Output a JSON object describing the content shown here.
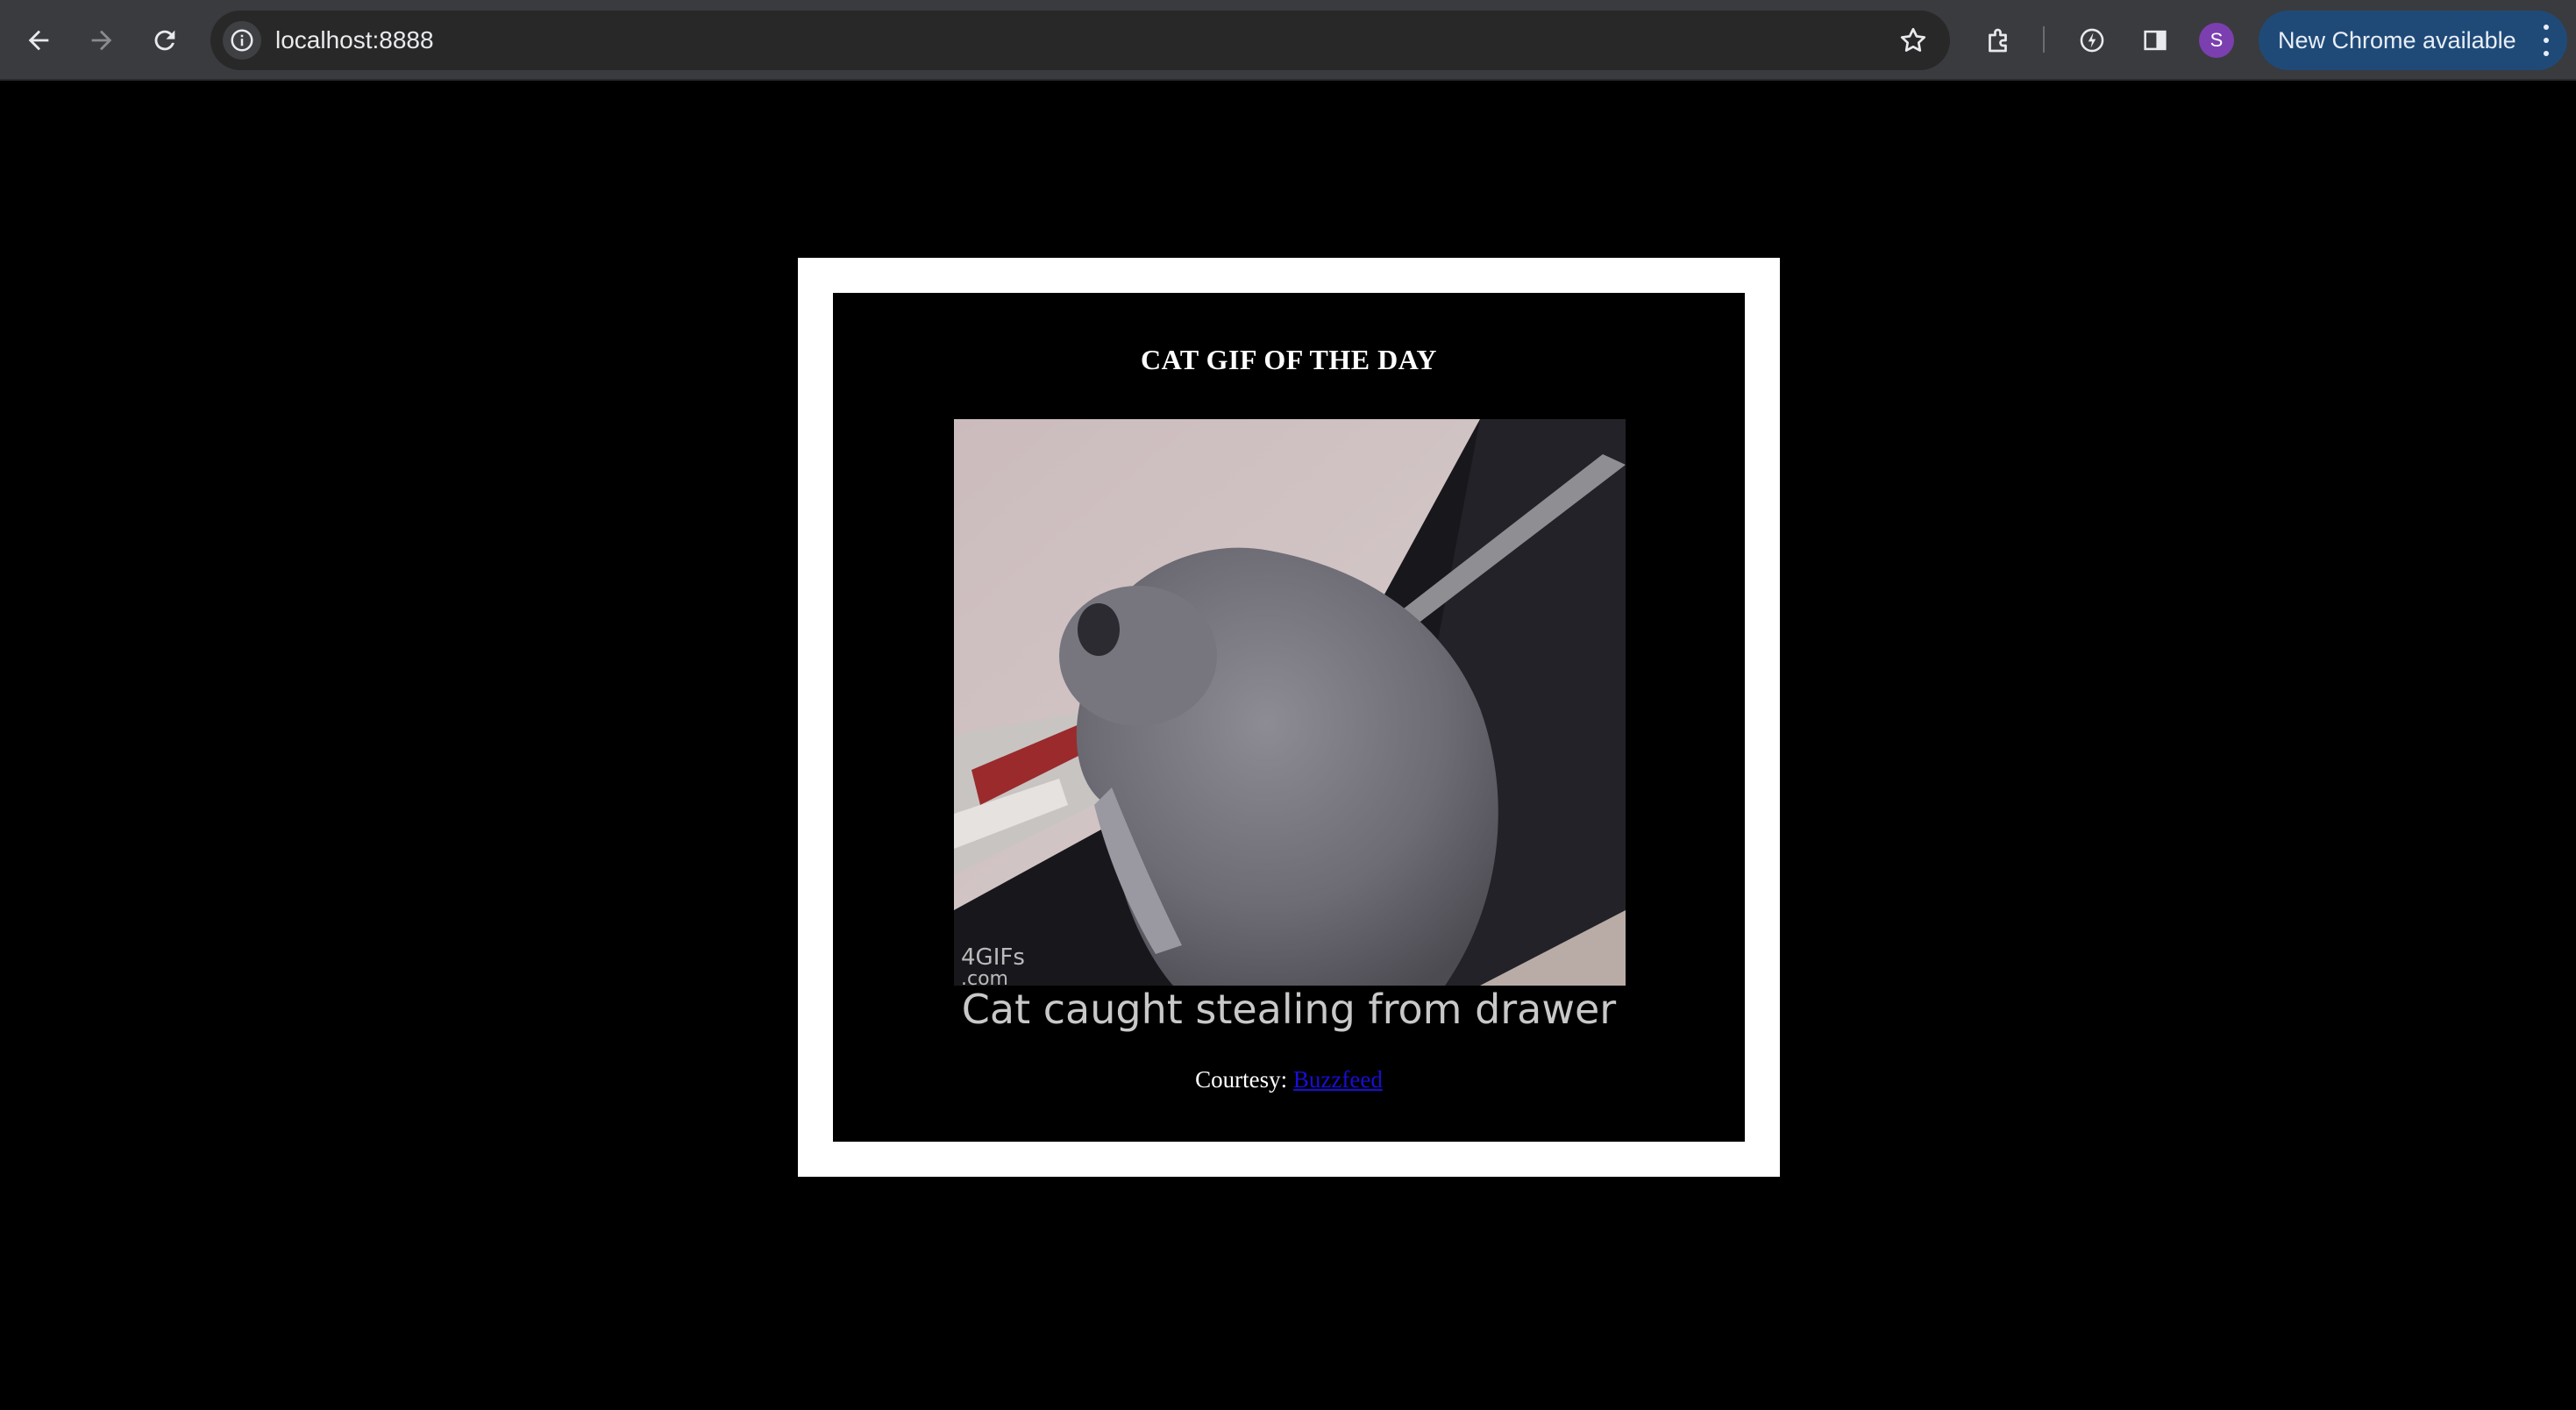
{
  "browser": {
    "url": "localhost:8888",
    "profile_initial": "S",
    "update_label": "New Chrome available",
    "icons": {
      "back": "back-arrow-icon",
      "forward": "forward-arrow-icon",
      "reload": "reload-icon",
      "site_info": "info-icon",
      "bookmark": "star-icon",
      "extensions": "puzzle-icon",
      "performance": "leaf-icon",
      "side_panel": "side-panel-icon",
      "menu": "more-vert-icon"
    }
  },
  "page": {
    "title": "CAT GIF OF THE DAY",
    "caption": "Cat caught stealing from drawer",
    "watermark_line1": "4GIFs",
    "watermark_line2": ".com",
    "courtesy_label": "Courtesy:",
    "courtesy_link": "Buzzfeed",
    "colors": {
      "page_bg": "#000000",
      "frame": "#ffffff",
      "link": "#1a0dd6",
      "update_pill": "#1f4a78",
      "avatar": "#7b3fb0"
    }
  }
}
